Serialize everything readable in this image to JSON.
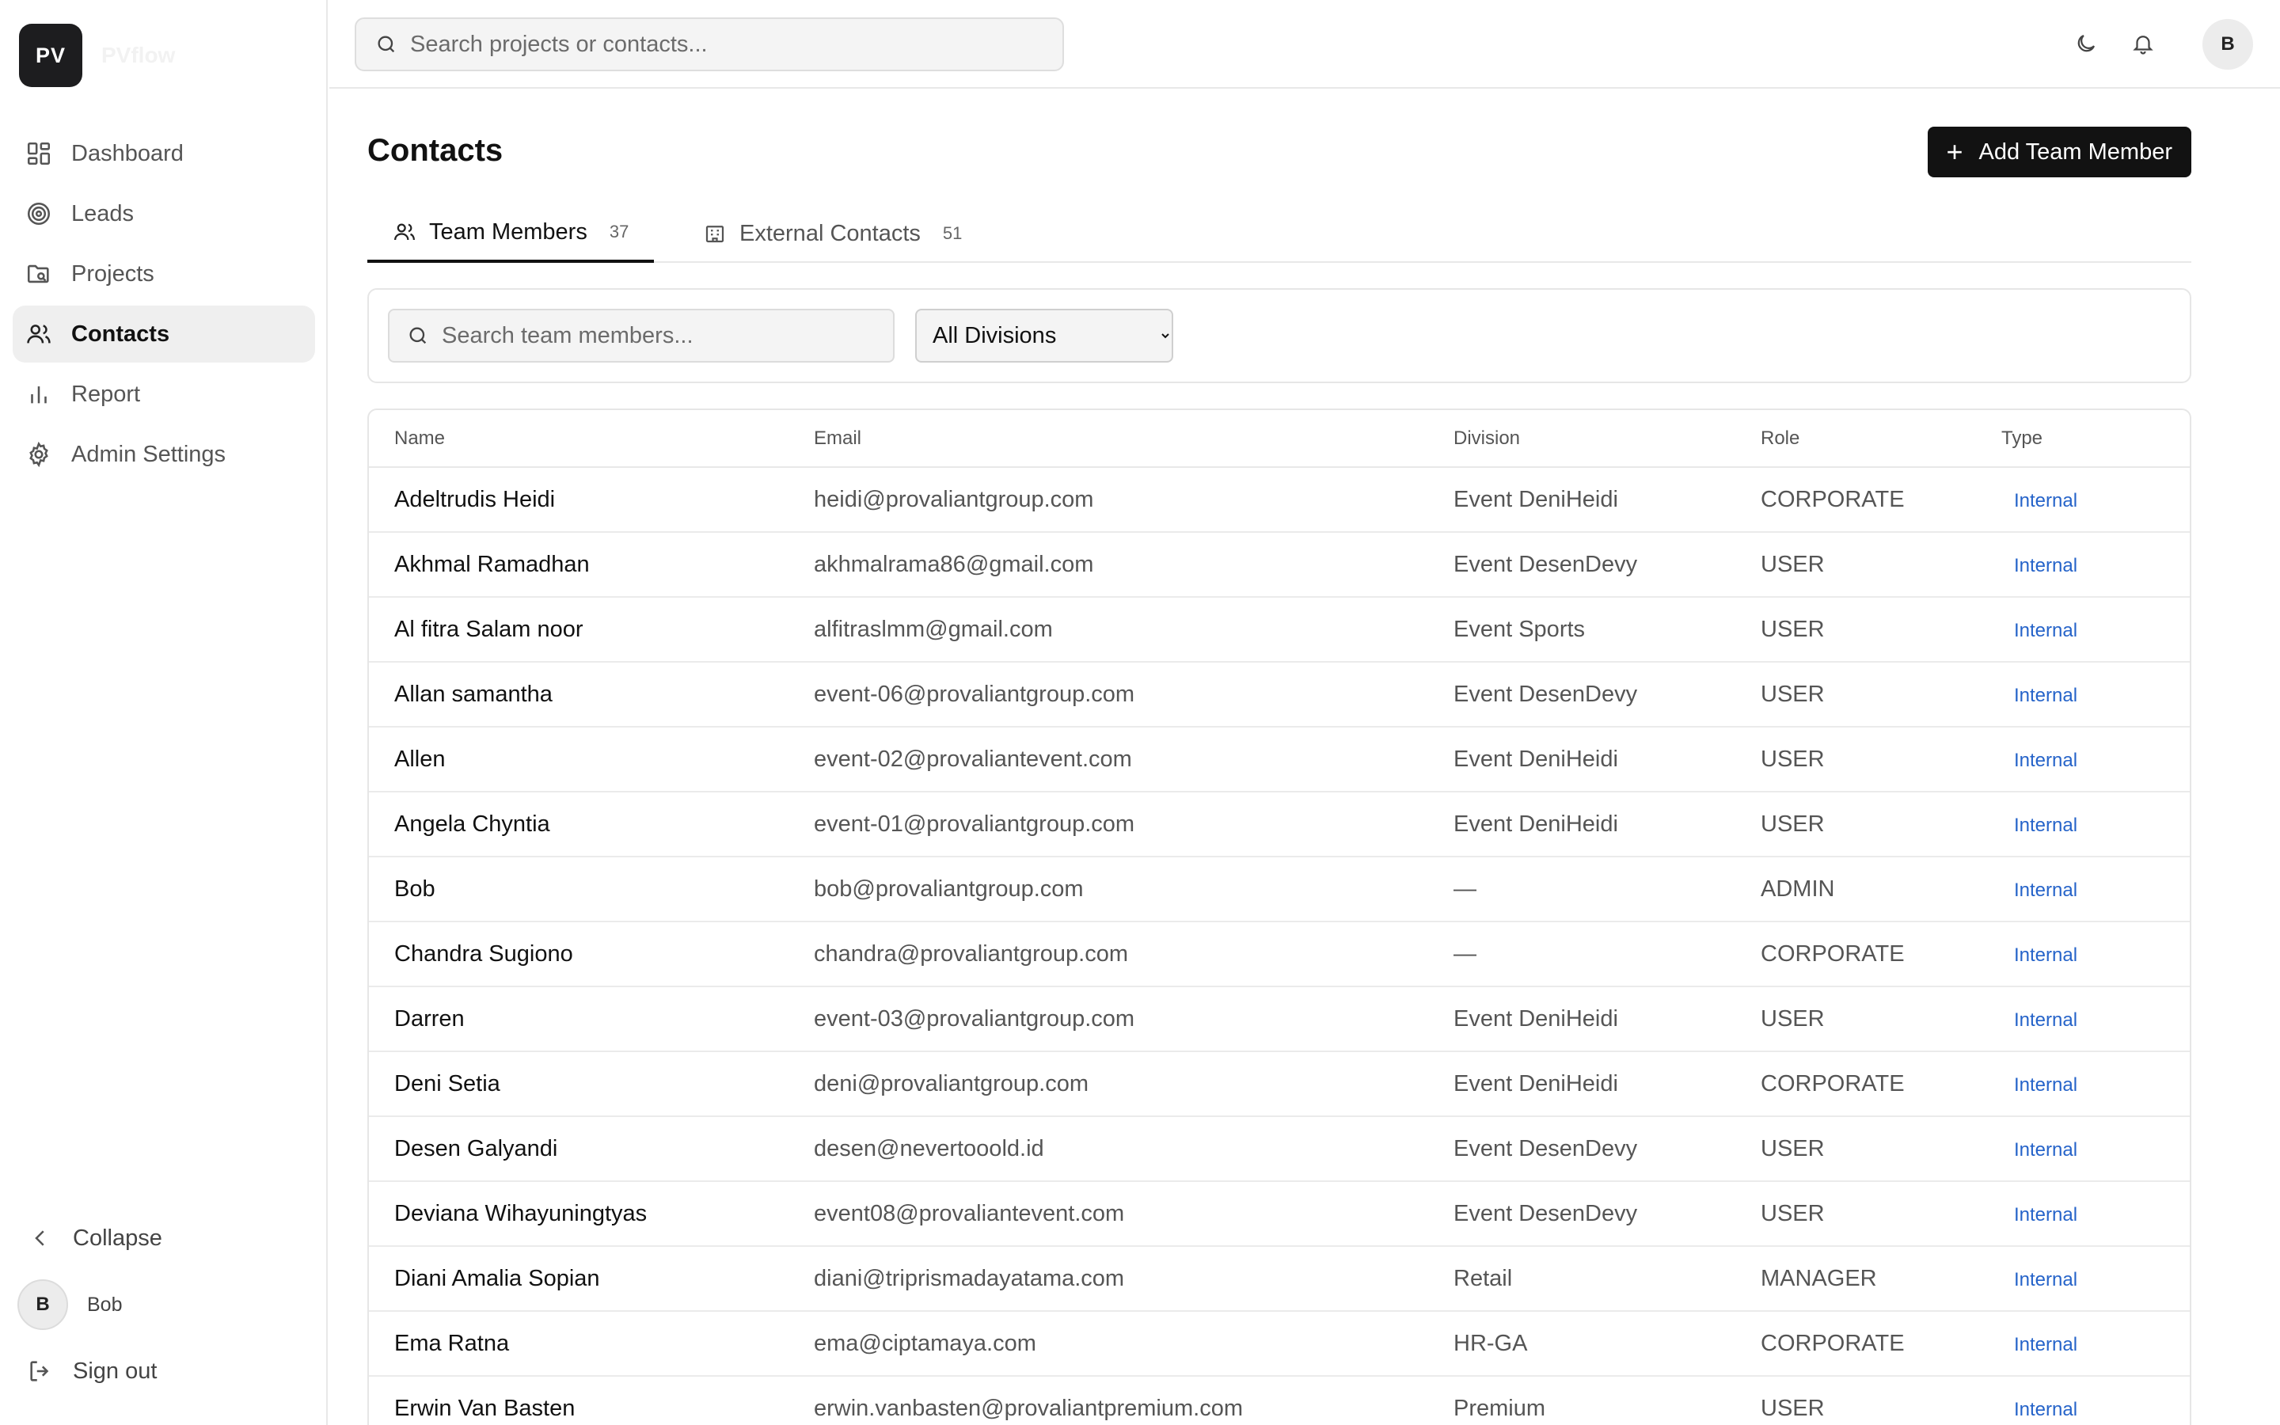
{
  "app": {
    "logo_initials": "PV",
    "logo_name": "PVflow"
  },
  "sidebar": {
    "items": [
      {
        "label": "Dashboard",
        "icon": "dashboard-icon"
      },
      {
        "label": "Leads",
        "icon": "target-icon"
      },
      {
        "label": "Projects",
        "icon": "folder-icon"
      },
      {
        "label": "Contacts",
        "icon": "users-icon",
        "active": true
      },
      {
        "label": "Report",
        "icon": "bar-chart-icon"
      },
      {
        "label": "Admin Settings",
        "icon": "gear-icon"
      }
    ],
    "collapse_label": "Collapse",
    "user": {
      "initial": "B",
      "name": "Bob"
    },
    "signout_label": "Sign out"
  },
  "topbar": {
    "search_placeholder": "Search projects or contacts...",
    "avatar_initial": "B"
  },
  "page": {
    "title": "Contacts",
    "add_button_label": "Add Team Member",
    "tabs": [
      {
        "label": "Team Members",
        "count": "37",
        "active": true
      },
      {
        "label": "External Contacts",
        "count": "51"
      }
    ],
    "member_search_placeholder": "Search team members...",
    "division_filter": "All Divisions"
  },
  "table": {
    "headers": [
      "Name",
      "Email",
      "Division",
      "Role",
      "Type"
    ],
    "rows": [
      {
        "name": "Adeltrudis Heidi",
        "email": "heidi@provaliantgroup.com",
        "division": "Event DeniHeidi",
        "role": "CORPORATE",
        "type": "Internal"
      },
      {
        "name": "Akhmal Ramadhan",
        "email": "akhmalrama86@gmail.com",
        "division": "Event DesenDevy",
        "role": "USER",
        "type": "Internal"
      },
      {
        "name": "Al fitra Salam noor",
        "email": "alfitraslmm@gmail.com",
        "division": "Event Sports",
        "role": "USER",
        "type": "Internal"
      },
      {
        "name": "Allan samantha",
        "email": "event-06@provaliantgroup.com",
        "division": "Event DesenDevy",
        "role": "USER",
        "type": "Internal"
      },
      {
        "name": "Allen",
        "email": "event-02@provaliantevent.com",
        "division": "Event DeniHeidi",
        "role": "USER",
        "type": "Internal"
      },
      {
        "name": "Angela Chyntia",
        "email": "event-01@provaliantgroup.com",
        "division": "Event DeniHeidi",
        "role": "USER",
        "type": "Internal"
      },
      {
        "name": "Bob",
        "email": "bob@provaliantgroup.com",
        "division": "—",
        "role": "ADMIN",
        "type": "Internal"
      },
      {
        "name": "Chandra Sugiono",
        "email": "chandra@provaliantgroup.com",
        "division": "—",
        "role": "CORPORATE",
        "type": "Internal"
      },
      {
        "name": "Darren",
        "email": "event-03@provaliantgroup.com",
        "division": "Event DeniHeidi",
        "role": "USER",
        "type": "Internal"
      },
      {
        "name": "Deni Setia",
        "email": "deni@provaliantgroup.com",
        "division": "Event DeniHeidi",
        "role": "CORPORATE",
        "type": "Internal"
      },
      {
        "name": "Desen Galyandi",
        "email": "desen@nevertooold.id",
        "division": "Event DesenDevy",
        "role": "USER",
        "type": "Internal"
      },
      {
        "name": "Deviana Wihayuningtyas",
        "email": "event08@provaliantevent.com",
        "division": "Event DesenDevy",
        "role": "USER",
        "type": "Internal"
      },
      {
        "name": "Diani Amalia Sopian",
        "email": "diani@triprismadayatama.com",
        "division": "Retail",
        "role": "MANAGER",
        "type": "Internal"
      },
      {
        "name": "Ema Ratna",
        "email": "ema@ciptamaya.com",
        "division": "HR-GA",
        "role": "CORPORATE",
        "type": "Internal"
      },
      {
        "name": "Erwin Van Basten",
        "email": "erwin.vanbasten@provaliantpremium.com",
        "division": "Premium",
        "role": "USER",
        "type": "Internal"
      }
    ]
  },
  "colors": {
    "accent_link": "#2563c9",
    "primary_button": "#121212",
    "active_nav": "#efefef"
  }
}
